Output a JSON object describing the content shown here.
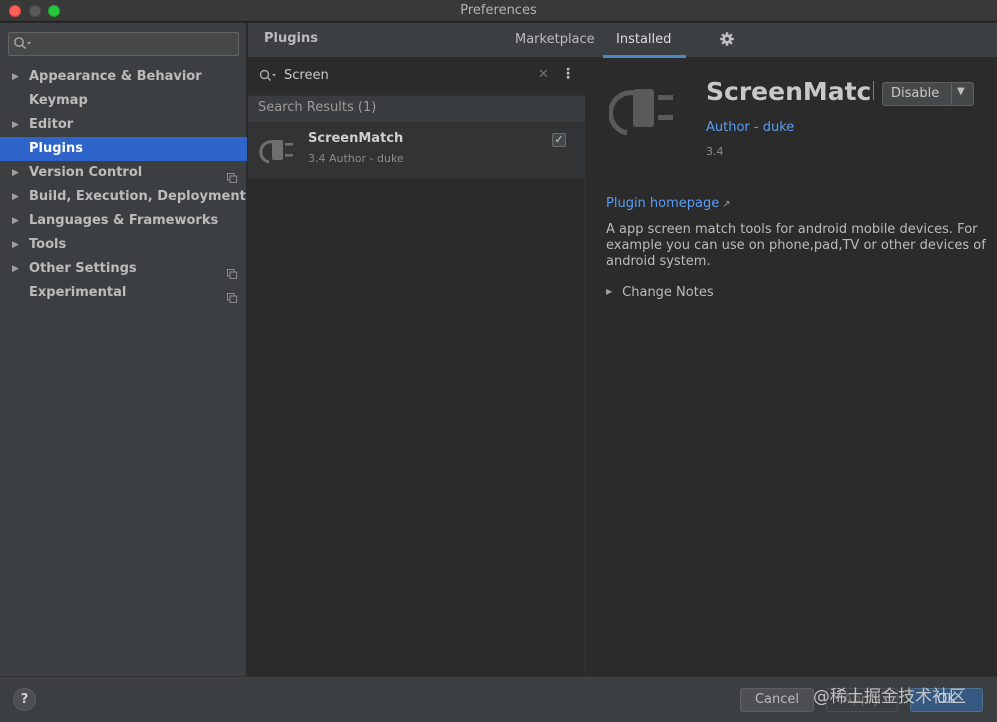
{
  "window": {
    "title": "Preferences"
  },
  "sidebar": {
    "search_placeholder": "",
    "items": [
      {
        "label": "Appearance & Behavior",
        "expandable": true,
        "project_icon": false,
        "selected": false
      },
      {
        "label": "Keymap",
        "expandable": false,
        "project_icon": false,
        "selected": false
      },
      {
        "label": "Editor",
        "expandable": true,
        "project_icon": false,
        "selected": false
      },
      {
        "label": "Plugins",
        "expandable": false,
        "project_icon": false,
        "selected": true
      },
      {
        "label": "Version Control",
        "expandable": true,
        "project_icon": true,
        "selected": false
      },
      {
        "label": "Build, Execution, Deployment",
        "expandable": true,
        "project_icon": false,
        "selected": false
      },
      {
        "label": "Languages & Frameworks",
        "expandable": true,
        "project_icon": false,
        "selected": false
      },
      {
        "label": "Tools",
        "expandable": true,
        "project_icon": false,
        "selected": false
      },
      {
        "label": "Other Settings",
        "expandable": true,
        "project_icon": true,
        "selected": false
      },
      {
        "label": "Experimental",
        "expandable": false,
        "project_icon": true,
        "selected": false
      }
    ]
  },
  "header": {
    "title": "Plugins",
    "tabs": [
      {
        "label": "Marketplace",
        "active": false
      },
      {
        "label": "Installed",
        "active": true
      }
    ],
    "settings_icon": "gear-icon"
  },
  "plugin_list": {
    "search_value": "Screen",
    "results_label": "Search Results (1)",
    "items": [
      {
        "name": "ScreenMatch",
        "meta": "3.4  Author - duke",
        "enabled": true
      }
    ]
  },
  "detail": {
    "name": "ScreenMatch",
    "disable_label": "Disable",
    "author": "Author - duke",
    "version": "3.4",
    "homepage_label": "Plugin homepage",
    "description": "A app screen match tools for android mobile devices. For example you can use on phone,pad,TV or other devices of android system.",
    "change_notes_label": "Change Notes"
  },
  "footer": {
    "help_label": "?",
    "cancel_label": "Cancel",
    "apply_label": "Apply",
    "ok_label": "OK",
    "watermark": "@稀土掘金技术社区"
  },
  "colors": {
    "accent": "#2f65ca",
    "link": "#589df6",
    "tab_underline": "#4a88c7"
  }
}
